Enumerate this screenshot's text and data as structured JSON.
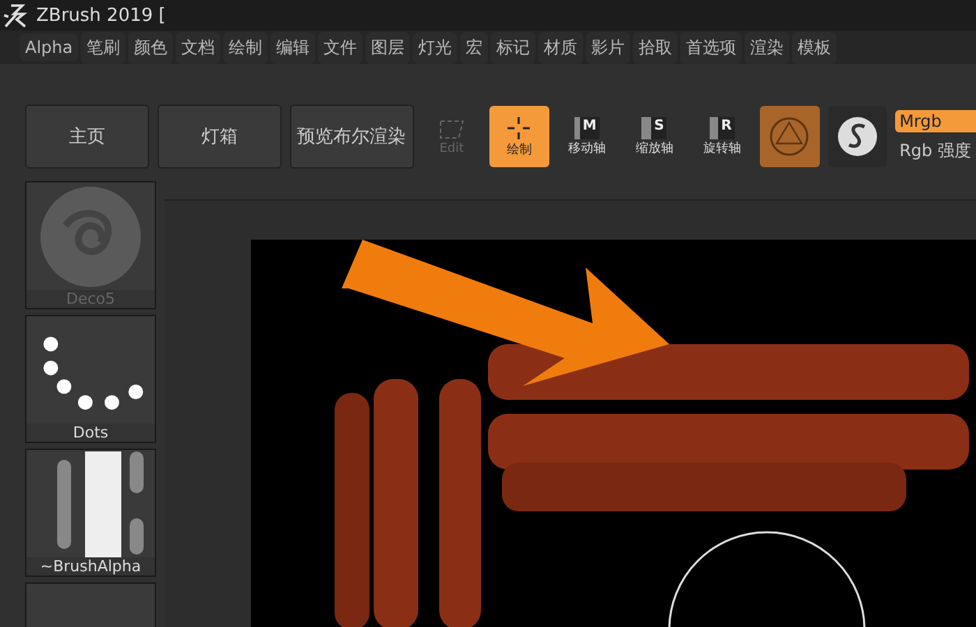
{
  "window": {
    "title": "ZBrush 2019 ["
  },
  "menu": [
    "Alpha",
    "笔刷",
    "颜色",
    "文档",
    "绘制",
    "编辑",
    "文件",
    "图层",
    "灯光",
    "宏",
    "标记",
    "材质",
    "影片",
    "拾取",
    "首选项",
    "渲染",
    "模板"
  ],
  "shelf": [
    "主页",
    "灯箱",
    "预览布尔渲染"
  ],
  "tools": [
    {
      "label": "Edit",
      "kind": "edit",
      "selected": false,
      "disabled": true
    },
    {
      "label": "绘制",
      "kind": "draw",
      "selected": true,
      "disabled": false
    },
    {
      "label": "移动轴",
      "kind": "axis",
      "key": "M",
      "selected": false,
      "disabled": false
    },
    {
      "label": "缩放轴",
      "kind": "axis",
      "key": "S",
      "selected": false,
      "disabled": false
    },
    {
      "label": "旋转轴",
      "kind": "axis",
      "key": "R",
      "selected": false,
      "disabled": false
    }
  ],
  "materials": [
    {
      "kind": "sphere",
      "selected": true
    },
    {
      "kind": "stroke",
      "selected": false
    }
  ],
  "rgb_modes": [
    {
      "label": "Mrgb",
      "selected": true
    },
    {
      "label": "Rgb 强度",
      "selected": false
    }
  ],
  "palette": [
    {
      "label": "Deco5",
      "kind": "deco",
      "dimmed": true
    },
    {
      "label": "Dots",
      "kind": "dots",
      "dimmed": false
    },
    {
      "label": "~BrushAlpha",
      "kind": "alpha",
      "dimmed": false
    },
    {
      "kind": "empty"
    }
  ]
}
